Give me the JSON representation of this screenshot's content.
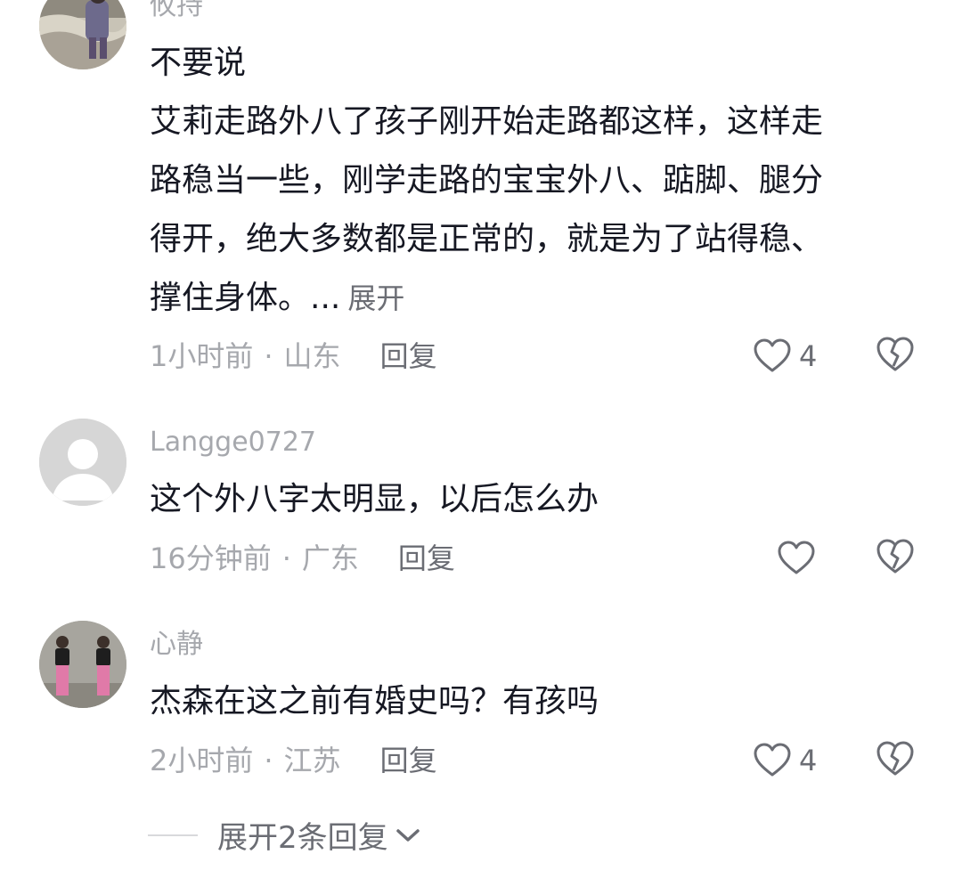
{
  "comments": [
    {
      "username": "攸持",
      "text_lines": [
        "不要说",
        "艾莉走路外八了孩子刚开始走路都这样，这样走",
        "路稳当一些，刚学走路的宝宝外八、踮脚、腿分",
        "得开，绝大多数都是正常的，就是为了站得稳、",
        "撑住身体。..."
      ],
      "expand_label": "展开",
      "time": "1小时前",
      "location": "山东",
      "reply_label": "回复",
      "like_count": "4",
      "avatar_icon": "photo-avatar-icon"
    },
    {
      "username": "Langge0727",
      "text_lines": [
        "这个外八字太明显，以后怎么办"
      ],
      "time": "16分钟前",
      "location": "广东",
      "reply_label": "回复",
      "like_count": "",
      "avatar_icon": "default-user-avatar-icon"
    },
    {
      "username": "心静",
      "text_lines": [
        "杰森在这之前有婚史吗？有孩吗"
      ],
      "time": "2小时前",
      "location": "江苏",
      "reply_label": "回复",
      "like_count": "4",
      "avatar_icon": "photo-avatar-icon"
    }
  ],
  "more_replies_label": "展开2条回复",
  "colors": {
    "text": "#161823",
    "secondary": "#a6a8ad",
    "action": "#6b6d74",
    "divider": "#d8d9dc"
  },
  "icons": [
    "heart-icon",
    "broken-heart-icon",
    "chevron-down-icon"
  ]
}
